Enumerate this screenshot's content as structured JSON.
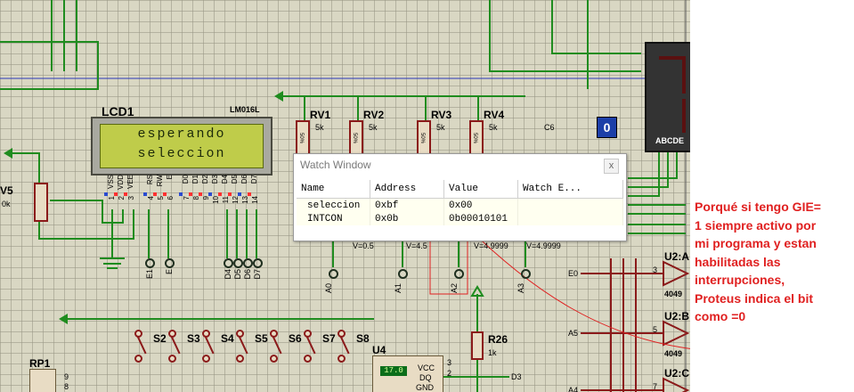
{
  "colors": {
    "wire": "#1f8c1f",
    "component": "#8b1a1a",
    "background": "#d9d7c3",
    "note": "#e02020",
    "hot": "#ff3030",
    "probe": "#2a4bd0"
  },
  "lcd": {
    "name": "LCD1",
    "model": "LM016L",
    "line1": "esperando",
    "line2": "seleccion",
    "pins": [
      "VSS",
      "VDD",
      "VEE",
      "RS",
      "RW",
      "E",
      "D0",
      "D1",
      "D2",
      "D3",
      "D4",
      "D5",
      "D6",
      "D7"
    ],
    "pin_numbers": [
      "1",
      "2",
      "3",
      "4",
      "5",
      "6",
      "7",
      "8",
      "9",
      "10",
      "11",
      "12",
      "13",
      "14"
    ]
  },
  "pots": [
    {
      "name": "RV1",
      "value": "5k",
      "volt": "V=0.5",
      "net": "A0"
    },
    {
      "name": "RV2",
      "value": "5k",
      "volt": "V=4.5",
      "net": "A1"
    },
    {
      "name": "RV3",
      "value": "5k",
      "volt": "V=4.9999",
      "net": "A2"
    },
    {
      "name": "RV4",
      "value": "5k",
      "volt": "V=4.9999",
      "net": "A3"
    }
  ],
  "pot_percent": "50%",
  "rv5": {
    "name": "V5",
    "value": "0k"
  },
  "lcd_nets": [
    "E1",
    "E",
    "D4",
    "D5",
    "D6",
    "D7"
  ],
  "c6": {
    "label": "C6",
    "value": "0"
  },
  "seven_seg_pins": "ABCDE",
  "switches": [
    "S2",
    "S3",
    "S4",
    "S5",
    "S6",
    "S7",
    "S8"
  ],
  "r26": {
    "name": "R26",
    "value": "1k",
    "net": "D3"
  },
  "u4": {
    "name": "U4",
    "display": "17.0",
    "pins": [
      "VCC",
      "DQ",
      "GND"
    ],
    "pin_numbers": [
      "3",
      "2"
    ]
  },
  "rp1": {
    "name": "RP1",
    "pins": [
      "9",
      "8"
    ]
  },
  "gates": [
    {
      "name": "U2:A",
      "input": "E0",
      "pin": "3",
      "type": "4049"
    },
    {
      "name": "U2:B",
      "input": "A5",
      "pin": "5",
      "type": "4049"
    },
    {
      "name": "U2:C",
      "input": "A4",
      "pin": "7",
      "type": ""
    }
  ],
  "watch": {
    "title": "Watch Window",
    "close": "x",
    "columns": [
      "Name",
      "Address",
      "Value",
      "Watch E..."
    ],
    "rows": [
      {
        "name": "seleccion",
        "address": "0xbf",
        "value": "0x00",
        "expr": ""
      },
      {
        "name": "INTCON",
        "address": "0x0b",
        "value": "0b00010101",
        "expr": ""
      }
    ]
  },
  "note": {
    "lines": [
      "Porqué si tengo GIE=",
      "1 siempre activo por",
      "mi programa y estan",
      "habilitadas las",
      "interrupciones,",
      "Proteus indica el bit",
      "como =0"
    ]
  }
}
